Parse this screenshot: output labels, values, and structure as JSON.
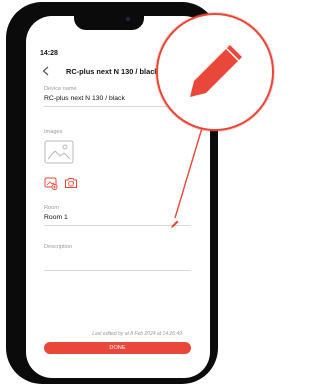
{
  "status_bar": {
    "time": "14:28"
  },
  "header": {
    "back_icon": "chevron-left-icon",
    "title": "RC-plus next N 130 / black"
  },
  "fields": {
    "device_name": {
      "label": "Device name",
      "value": "RC-plus next N 130 / black"
    },
    "images": {
      "label": "Images",
      "placeholder_icon": "image-icon",
      "add_icon": "add-image-icon",
      "camera_icon": "camera-refresh-icon"
    },
    "room": {
      "label": "Room",
      "value": "Room 1"
    },
    "description": {
      "label": "Description",
      "value": ""
    }
  },
  "footer": {
    "last_edited": "Last edited by at 8 Feb 2024 at 14:26:49",
    "done_label": "DONE"
  },
  "callout": {
    "icon": "pencil-icon"
  },
  "colors": {
    "accent": "#e8473a",
    "frame": "#0b0b0c"
  }
}
